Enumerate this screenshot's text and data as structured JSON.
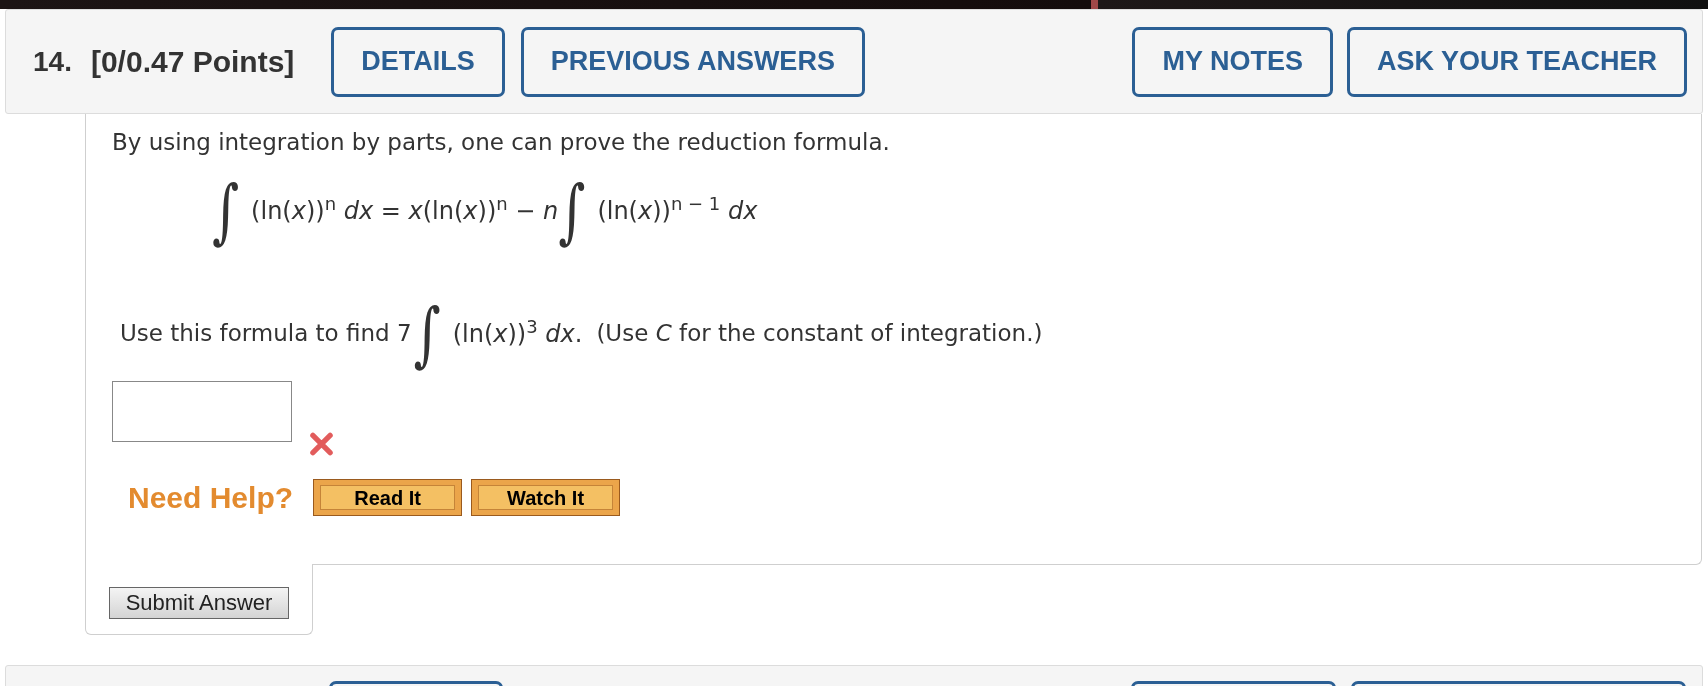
{
  "header": {
    "number": "14.",
    "points": "[0/0.47 Points]",
    "left_buttons": [
      "DETAILS",
      "PREVIOUS ANSWERS"
    ],
    "right_buttons": [
      "MY NOTES",
      "ASK YOUR TEACHER"
    ]
  },
  "question": {
    "intro": "By using integration by parts, one can prove the reduction formula.",
    "formula": [
      {
        "kind": "integral",
        "text": "∫"
      },
      {
        "kind": "math",
        "text": "(ln(*x*))$^{n}$ *dx* = *x*(ln(*x*))$^{n}$ − *n*"
      },
      {
        "kind": "integral",
        "text": "∫"
      },
      {
        "kind": "math",
        "text": "(ln(*x*))$^{n − 1}$ *dx*"
      }
    ],
    "task": [
      {
        "kind": "text",
        "text": "Use this formula to find 7"
      },
      {
        "kind": "integral",
        "text": "∫"
      },
      {
        "kind": "math",
        "text": "(ln(*x*))$^{3}$ *dx*."
      },
      {
        "kind": "text",
        "text": "(Use *C* for the constant of integration.)"
      }
    ]
  },
  "answer": {
    "correct": false
  },
  "help": {
    "label": "Need Help?",
    "buttons": [
      "Read It",
      "Watch It"
    ]
  },
  "submit": "Submit Answer"
}
